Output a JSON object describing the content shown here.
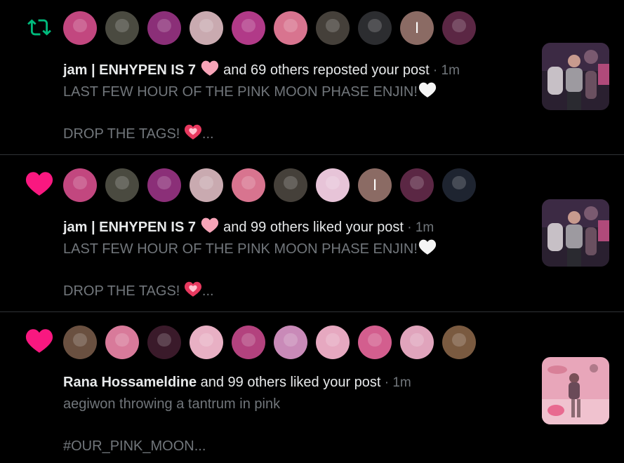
{
  "colors": {
    "repost_green": "#00ba7c",
    "like_pink": "#f91880",
    "text_primary": "#e7e9ea",
    "text_secondary": "#71767b",
    "divider": "#2f3336"
  },
  "notifications": [
    {
      "type_icon": "repost-icon",
      "avatars": [
        {
          "color": "#c2477f",
          "letter": ""
        },
        {
          "color": "#4a4a40",
          "letter": ""
        },
        {
          "color": "#8b2f78",
          "letter": ""
        },
        {
          "color": "#c9aab0",
          "letter": ""
        },
        {
          "color": "#b13a88",
          "letter": ""
        },
        {
          "color": "#d8748f",
          "letter": ""
        },
        {
          "color": "#45403a",
          "letter": ""
        },
        {
          "color": "#2c2d30",
          "letter": ""
        },
        {
          "color": "#8b6b64",
          "letter": "I"
        },
        {
          "color": "#5b2744",
          "letter": ""
        }
      ],
      "name": "jam | ENHYPEN IS 7",
      "name_emoji": "pink-heart-emoji",
      "action": " and 69 others reposted your post",
      "dot": " · ",
      "time": "1m",
      "text": "LAST FEW HOUR OF THE PINK MOON PHASE ENJIN!",
      "text_emoji": "white-heart-emoji",
      "tags": "DROP THE TAGS! ",
      "tags_emoji": "heart-ribbon-emoji",
      "ellipsis": "...",
      "thumb_colors": [
        "#3a2a3a",
        "#8a6a7a",
        "#c8a0b0"
      ]
    },
    {
      "type_icon": "heart-icon",
      "avatars": [
        {
          "color": "#c2477f",
          "letter": ""
        },
        {
          "color": "#4a4a40",
          "letter": ""
        },
        {
          "color": "#8b2f78",
          "letter": ""
        },
        {
          "color": "#c9aab0",
          "letter": ""
        },
        {
          "color": "#d8748f",
          "letter": ""
        },
        {
          "color": "#45403a",
          "letter": ""
        },
        {
          "color": "#e7c4d8",
          "letter": ""
        },
        {
          "color": "#8b6b64",
          "letter": "I"
        },
        {
          "color": "#5b2744",
          "letter": ""
        },
        {
          "color": "#1e2430",
          "letter": ""
        }
      ],
      "name": "jam | ENHYPEN IS 7",
      "name_emoji": "pink-heart-emoji",
      "action": " and 99 others liked your post",
      "dot": " · ",
      "time": "1m",
      "text": "LAST FEW HOUR OF THE PINK MOON PHASE ENJIN!",
      "text_emoji": "white-heart-emoji",
      "tags": "DROP THE TAGS! ",
      "tags_emoji": "heart-ribbon-emoji",
      "ellipsis": "...",
      "thumb_colors": [
        "#3a2a3a",
        "#8a6a7a",
        "#c8a0b0"
      ]
    },
    {
      "type_icon": "heart-icon",
      "avatars": [
        {
          "color": "#6a5040",
          "letter": ""
        },
        {
          "color": "#d87a9a",
          "letter": ""
        },
        {
          "color": "#3a1a2a",
          "letter": ""
        },
        {
          "color": "#e8b0c4",
          "letter": ""
        },
        {
          "color": "#b3427e",
          "letter": ""
        },
        {
          "color": "#c98ab8",
          "letter": ""
        },
        {
          "color": "#e6a8c0",
          "letter": ""
        },
        {
          "color": "#d35e8e",
          "letter": ""
        },
        {
          "color": "#e0a4bc",
          "letter": ""
        },
        {
          "color": "#7a5a40",
          "letter": ""
        }
      ],
      "name": "Rana Hossameldine",
      "name_emoji": "",
      "action": " and 99 others liked your post",
      "dot": " · ",
      "time": "1m",
      "text": "aegiwon throwing a tantrum in pink",
      "text_emoji": "",
      "tags": "#OUR_PINK_MOON",
      "tags_emoji": "",
      "ellipsis": "...",
      "thumb_colors": [
        "#e8a0b4",
        "#d88aa0",
        "#f0c0cc"
      ]
    }
  ]
}
